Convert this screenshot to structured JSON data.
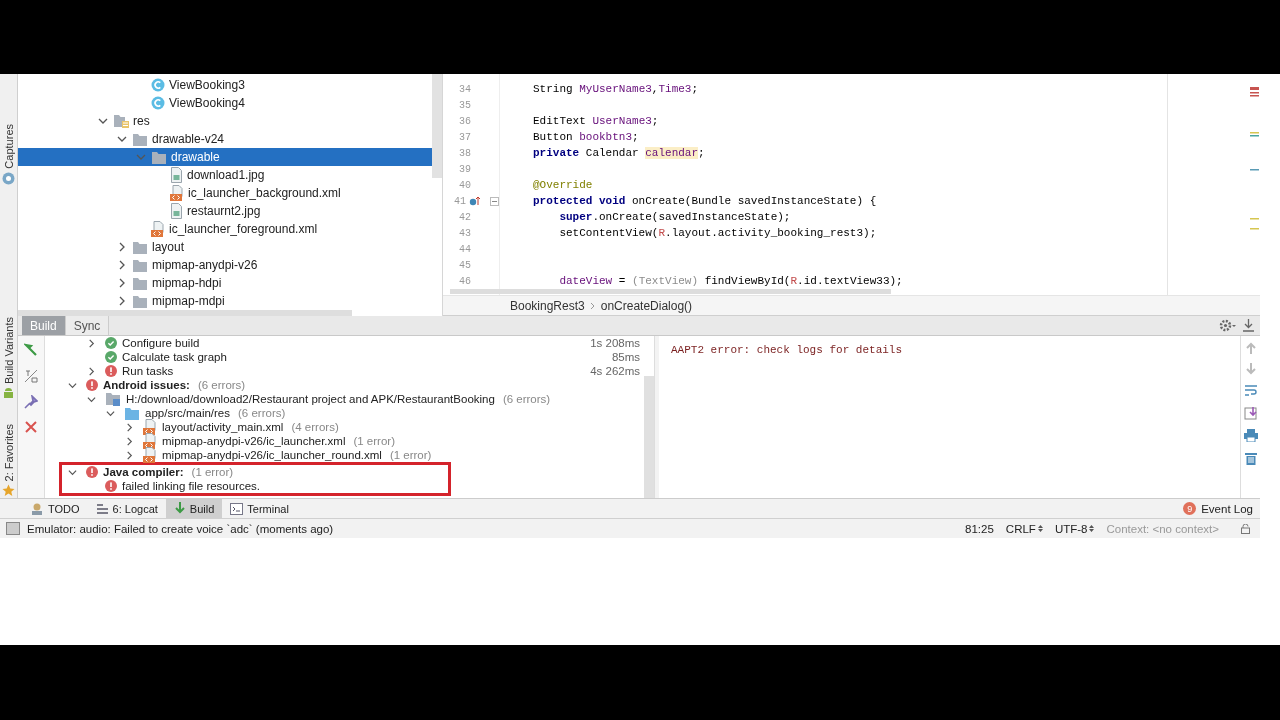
{
  "left_strip": [
    {
      "label": "Captures",
      "kind": "captures"
    },
    {
      "label": "Build Variants",
      "kind": "android"
    },
    {
      "label": "2: Favorites",
      "kind": "star"
    }
  ],
  "project_tree": {
    "cut_items": [
      {
        "label": "ViewBooking3",
        "kind": "class",
        "selected": false
      },
      {
        "label": "ViewBooking4",
        "kind": "class",
        "selected": false
      }
    ],
    "items": [
      {
        "label": "res",
        "kind": "res",
        "expanded": true,
        "selected": false,
        "children": [
          {
            "label": "drawable-v24",
            "kind": "folder",
            "expanded": true,
            "selected": false,
            "children": [
              {
                "label": "drawable",
                "kind": "folder",
                "expanded": true,
                "selected": true,
                "children": [
                  {
                    "label": "download1.jpg",
                    "kind": "image",
                    "selected": false
                  },
                  {
                    "label": "ic_launcher_background.xml",
                    "kind": "xml",
                    "selected": false
                  },
                  {
                    "label": "restaurnt2.jpg",
                    "kind": "image",
                    "selected": false
                  }
                ]
              },
              {
                "label": "ic_launcher_foreground.xml",
                "kind": "xml",
                "selected": false
              }
            ]
          },
          {
            "label": "layout",
            "kind": "folder",
            "expanded": false,
            "selected": false
          },
          {
            "label": "mipmap-anydpi-v26",
            "kind": "folder",
            "expanded": false,
            "selected": false
          },
          {
            "label": "mipmap-hdpi",
            "kind": "folder",
            "expanded": false,
            "selected": false
          },
          {
            "label": "mipmap-mdpi",
            "kind": "folder",
            "expanded": false,
            "selected": false
          }
        ]
      }
    ]
  },
  "editor": {
    "lines": [
      {
        "number": "34",
        "tokens": [
          {
            "kind": "plain",
            "text": "String "
          },
          {
            "kind": "field",
            "text": "MyUserName3"
          },
          {
            "kind": "plain",
            "text": ","
          },
          {
            "kind": "field",
            "text": "Time3"
          },
          {
            "kind": "plain",
            "text": ";"
          }
        ]
      },
      {
        "number": "35"
      },
      {
        "number": "36",
        "tokens": [
          {
            "kind": "plain",
            "text": "EditText "
          },
          {
            "kind": "field",
            "text": "UserName3"
          },
          {
            "kind": "plain",
            "text": ";"
          }
        ]
      },
      {
        "number": "37",
        "tokens": [
          {
            "kind": "plain",
            "text": "Button "
          },
          {
            "kind": "field",
            "text": "bookbtn3"
          },
          {
            "kind": "plain",
            "text": ";"
          }
        ]
      },
      {
        "number": "38",
        "tokens": [
          {
            "kind": "keyword",
            "text": "private"
          },
          {
            "kind": "plain",
            "text": " Calendar "
          },
          {
            "kind": "highlight",
            "text": "calendar"
          },
          {
            "kind": "plain",
            "text": ";"
          }
        ]
      },
      {
        "number": "39"
      },
      {
        "number": "40",
        "tokens": [
          {
            "kind": "annotation",
            "text": "@Override"
          }
        ]
      },
      {
        "number": "41",
        "kind": "override",
        "tokens": [
          {
            "kind": "keyword",
            "text": "protected void"
          },
          {
            "kind": "plain",
            "text": " onCreate(Bundle savedInstanceState) {"
          }
        ]
      },
      {
        "number": "42",
        "tokens": [
          {
            "kind": "keyword",
            "text": "    super"
          },
          {
            "kind": "plain",
            "text": ".onCreate(savedInstanceState);"
          }
        ]
      },
      {
        "number": "43",
        "tokens": [
          {
            "kind": "plain",
            "text": "    setContentView("
          },
          {
            "kind": "resource",
            "text": "R"
          },
          {
            "kind": "plain",
            "text": ".layout.activity_booking_rest3);"
          }
        ]
      },
      {
        "number": "44"
      },
      {
        "number": "45"
      },
      {
        "number": "46",
        "tokens": [
          {
            "kind": "field",
            "text": "    dateView"
          },
          {
            "kind": "plain",
            "text": " = "
          },
          {
            "kind": "muted",
            "text": "(TextView)"
          },
          {
            "kind": "plain",
            "text": " findViewById("
          },
          {
            "kind": "resource",
            "text": "R"
          },
          {
            "kind": "plain",
            "text": ".id.textView33);"
          }
        ]
      }
    ],
    "breadcrumbs": [
      "BookingRest3",
      "onCreateDialog()"
    ]
  },
  "build": {
    "tabs": [
      {
        "label": "Build",
        "selected": true
      },
      {
        "label": "Sync",
        "selected": false
      }
    ],
    "tree": {
      "cut_items": [
        {
          "label": "Configure build",
          "kind": "ok",
          "expanded": false,
          "time": "1s 208ms"
        },
        {
          "label": "Calculate task graph",
          "kind": "ok",
          "time": "85ms"
        },
        {
          "label": "Run tasks",
          "kind": "error",
          "expanded": false,
          "time": "4s 262ms"
        }
      ],
      "items": [
        {
          "label": "Android issues:",
          "kind": "error",
          "count": "(6 errors)",
          "expanded": true,
          "framed": false,
          "children": [
            {
              "label": "H:/download/download2/Restaurant project and APK/RestaurantBooking",
              "kind": "module",
              "count": "(6 errors)",
              "expanded": true,
              "children": [
                {
                  "label": "app/src/main/res",
                  "kind": "bluefolder",
                  "count": "(6 errors)",
                  "expanded": true,
                  "children": [
                    {
                      "label": "layout/activity_main.xml",
                      "kind": "xml",
                      "count": "(4 errors)",
                      "expanded": false
                    },
                    {
                      "label": "mipmap-anydpi-v26/ic_launcher.xml",
                      "kind": "xml",
                      "count": "(1 error)",
                      "expanded": false
                    },
                    {
                      "label": "mipmap-anydpi-v26/ic_launcher_round.xml",
                      "kind": "xml",
                      "count": "(1 error)",
                      "expanded": false
                    }
                  ]
                }
              ]
            }
          ]
        },
        {
          "label": "Java compiler:",
          "kind": "error",
          "count": "(1 error)",
          "expanded": true,
          "framed": true,
          "children": [
            {
              "label": "failed linking file resources.",
              "kind": "error"
            }
          ]
        }
      ]
    },
    "console": "AAPT2 error: check logs for details"
  },
  "bottom_tabs": [
    {
      "label": "TODO",
      "kind": "todo",
      "selected": false
    },
    {
      "label": "6: Logcat",
      "kind": "logcat",
      "selected": false
    },
    {
      "label": "Build",
      "kind": "build",
      "selected": true
    },
    {
      "label": "Terminal",
      "kind": "terminal",
      "selected": false
    }
  ],
  "event_log": {
    "label": "Event Log",
    "badge": "9"
  },
  "status_bar": {
    "message": "Emulator: audio: Failed to create voice `adc` (moments ago)",
    "position": "81:25",
    "line_separator": "CRLF",
    "encoding": "UTF-8",
    "context": "Context: <no context>"
  }
}
